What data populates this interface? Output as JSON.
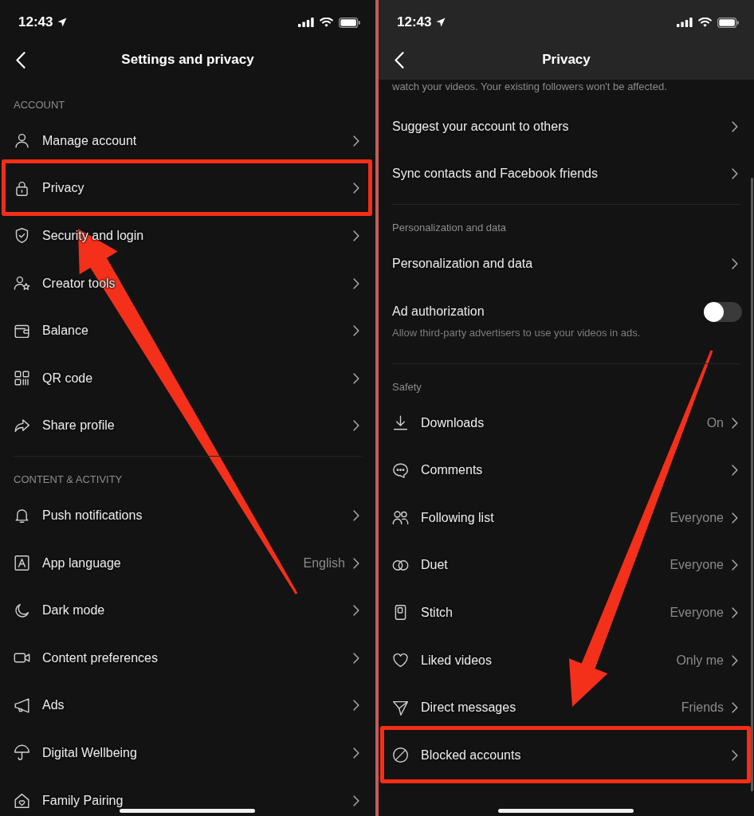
{
  "screens": [
    {
      "status_bar": {
        "time": "12:43"
      },
      "title": "Settings and privacy",
      "scrolled": false,
      "sections": [
        {
          "header": "ACCOUNT",
          "items": [
            {
              "kind": "icon_link",
              "label": "Manage account",
              "highlighted": false
            },
            {
              "kind": "icon_link",
              "label": "Privacy",
              "highlighted": true
            },
            {
              "kind": "icon_link",
              "label": "Security and login",
              "highlighted": false
            },
            {
              "kind": "icon_link",
              "label": "Creator tools",
              "highlighted": false
            },
            {
              "kind": "icon_link",
              "label": "Balance",
              "highlighted": false
            },
            {
              "kind": "icon_link",
              "label": "QR code",
              "highlighted": false
            },
            {
              "kind": "icon_link",
              "label": "Share profile",
              "highlighted": false
            }
          ]
        },
        {
          "header": "CONTENT & ACTIVITY",
          "items": [
            {
              "kind": "icon_link",
              "label": "Push notifications",
              "highlighted": false
            },
            {
              "kind": "icon_link",
              "label": "App language",
              "value": "English",
              "highlighted": false
            },
            {
              "kind": "icon_link",
              "label": "Dark mode",
              "highlighted": false
            },
            {
              "kind": "icon_link",
              "label": "Content preferences",
              "highlighted": false
            },
            {
              "kind": "icon_link",
              "label": "Ads",
              "highlighted": false
            },
            {
              "kind": "icon_link",
              "label": "Digital Wellbeing",
              "highlighted": false
            },
            {
              "kind": "icon_link",
              "label": "Family Pairing",
              "highlighted": false
            }
          ]
        }
      ]
    },
    {
      "status_bar": {
        "time": "12:43"
      },
      "title": "Privacy",
      "scrolled": true,
      "sections": [
        {
          "items": [
            {
              "kind": "note",
              "text": "watch your videos. Your existing followers won't be affected.",
              "highlighted": false
            },
            {
              "kind": "link",
              "label": "Suggest your account to others",
              "highlighted": false
            },
            {
              "kind": "link",
              "label": "Sync contacts and Facebook friends",
              "highlighted": false
            }
          ]
        },
        {
          "header": "Personalization and data",
          "items": [
            {
              "kind": "link",
              "label": "Personalization and data",
              "highlighted": false
            },
            {
              "kind": "toggle",
              "label": "Ad authorization",
              "description": "Allow third-party advertisers to use your videos in ads.",
              "on": false,
              "highlighted": false
            }
          ]
        },
        {
          "header": "Safety",
          "items": [
            {
              "kind": "icon_link",
              "label": "Downloads",
              "value": "On",
              "highlighted": false
            },
            {
              "kind": "icon_link",
              "label": "Comments",
              "highlighted": false
            },
            {
              "kind": "icon_link",
              "label": "Following list",
              "value": "Everyone",
              "highlighted": false
            },
            {
              "kind": "icon_link",
              "label": "Duet",
              "value": "Everyone",
              "highlighted": false
            },
            {
              "kind": "icon_link",
              "label": "Stitch",
              "value": "Everyone",
              "highlighted": false
            },
            {
              "kind": "icon_link",
              "label": "Liked videos",
              "value": "Only me",
              "highlighted": false
            },
            {
              "kind": "icon_link",
              "label": "Direct messages",
              "value": "Friends",
              "highlighted": false
            },
            {
              "kind": "icon_link",
              "label": "Blocked accounts",
              "highlighted": true
            }
          ]
        }
      ]
    }
  ]
}
